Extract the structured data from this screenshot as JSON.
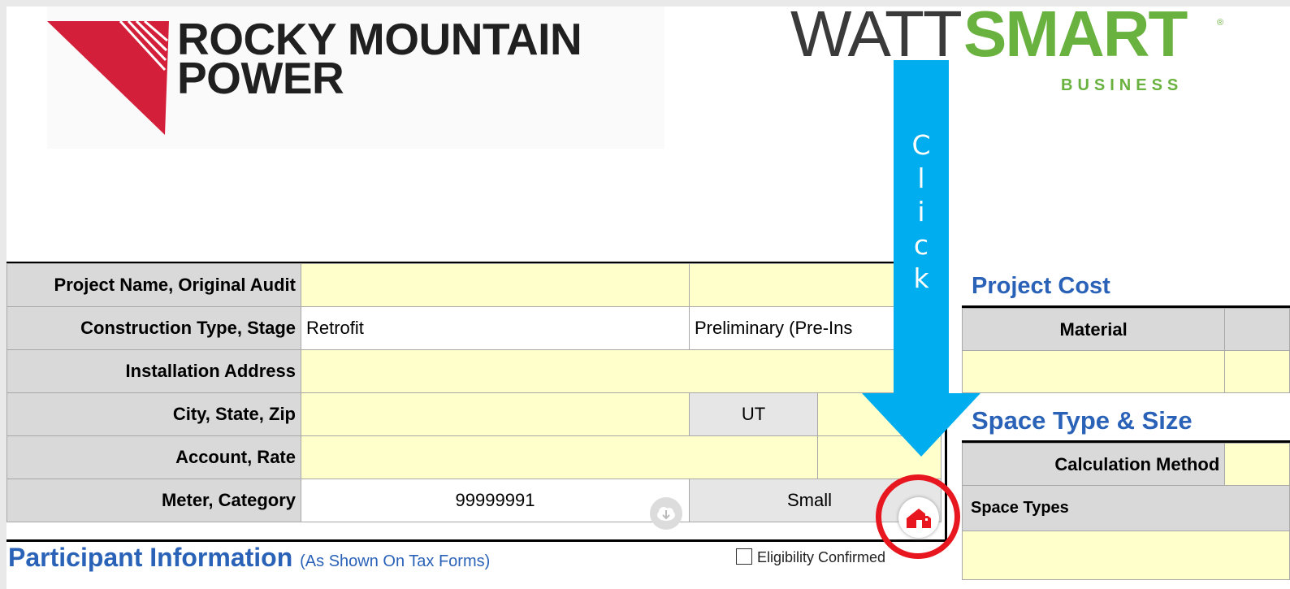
{
  "logos": {
    "rocky_line1": "ROCKY MOUNTAIN",
    "rocky_line2": "POWER",
    "ws_watt": "WATT",
    "ws_smart": "SMART",
    "ws_reg": "®",
    "ws_business": "BUSINESS"
  },
  "annotation": {
    "arrow_text": [
      "C",
      "l",
      "i",
      "c",
      "k"
    ],
    "arrow_color": "#00aeef",
    "circle_color": "#e8171f"
  },
  "form": {
    "rows": [
      {
        "label": "Project Name, Original Audit",
        "value1": "",
        "value2": ""
      },
      {
        "label": "Construction Type, Stage",
        "value1": "Retrofit",
        "value2": "Preliminary (Pre-Ins"
      },
      {
        "label": "Installation Address",
        "value1": ""
      },
      {
        "label": "City, State, Zip",
        "value1": "",
        "value2": "UT",
        "value3": ""
      },
      {
        "label": "Account, Rate",
        "value1": "",
        "value2": ""
      },
      {
        "label": "Meter, Category",
        "value1": "99999991",
        "value2": "Small"
      }
    ],
    "participant_title": "Participant Information",
    "participant_note": "(As Shown On Tax Forms)",
    "eligibility_label": "Eligibility Confirmed"
  },
  "right": {
    "project_cost_title": "Project Cost",
    "material_header": "Material",
    "space_title": "Space Type & Size",
    "calc_method_label": "Calculation Method",
    "space_types_label": "Space Types"
  },
  "icons": {
    "cloud": "cloud-download-icon",
    "home": "home-building-icon"
  }
}
